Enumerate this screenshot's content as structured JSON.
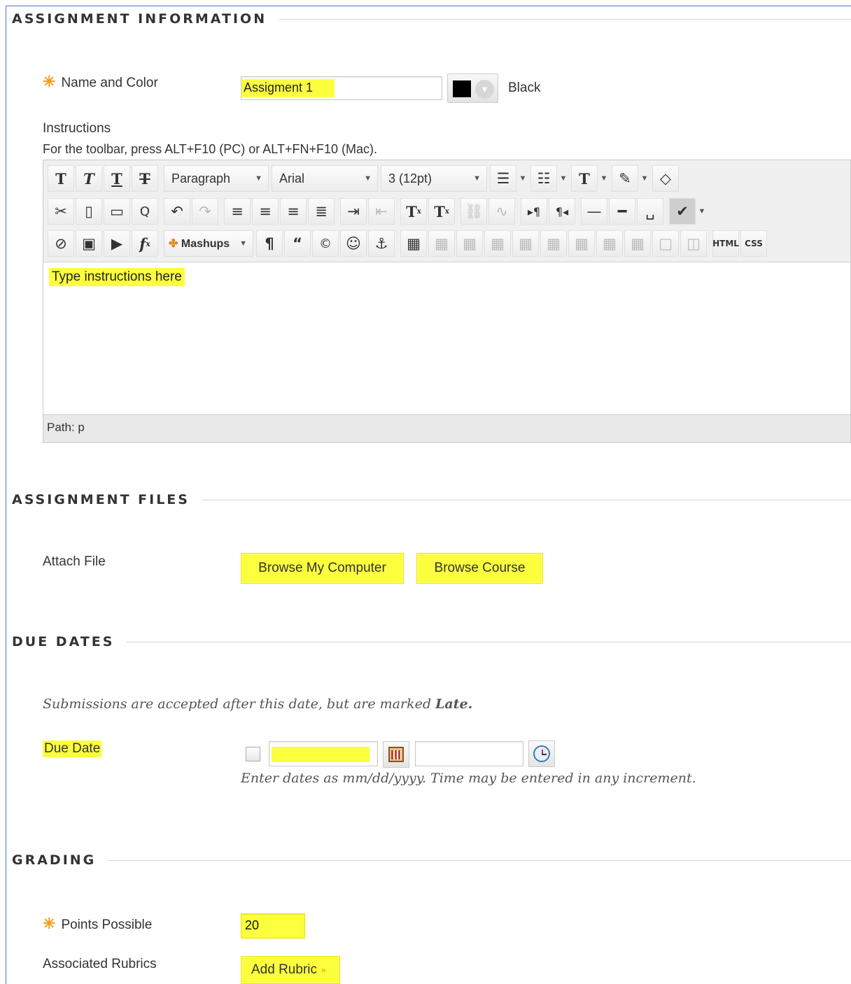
{
  "sections": {
    "info": "ASSIGNMENT INFORMATION",
    "files": "ASSIGNMENT FILES",
    "due": "DUE DATES",
    "grading": "GRADING"
  },
  "info": {
    "name_label": "Name and Color",
    "name_value": "Assigment 1",
    "color_name": "Black",
    "swatch_color": "#000000",
    "instructions_label": "Instructions",
    "toolbar_hint": "For the toolbar, press ALT+F10 (PC) or ALT+FN+F10 (Mac)."
  },
  "editor": {
    "paragraph_select": "Paragraph",
    "font_select": "Arial",
    "size_select": "3 (12pt)",
    "mashups_label": "Mashups",
    "html_label": "HTML",
    "css_label": "CSS",
    "placeholder": "Type instructions here",
    "path_label": "Path: p"
  },
  "files": {
    "attach_label": "Attach File",
    "browse_computer": "Browse My Computer",
    "browse_course": "Browse Course"
  },
  "due": {
    "note_prefix": "Submissions are accepted after this date, but are marked ",
    "note_bold": "Late.",
    "due_date_label": "Due Date",
    "date_hint": "Enter dates as mm/dd/yyyy. Time may be entered in any increment."
  },
  "grading": {
    "points_label": "Points Possible",
    "points_value": "20",
    "rubrics_label": "Associated Rubrics",
    "add_rubric": "Add Rubric"
  },
  "colors": {
    "highlight": "#fbff3c",
    "required_star": "#f39a1c",
    "frame_border": "#4b75c4"
  }
}
